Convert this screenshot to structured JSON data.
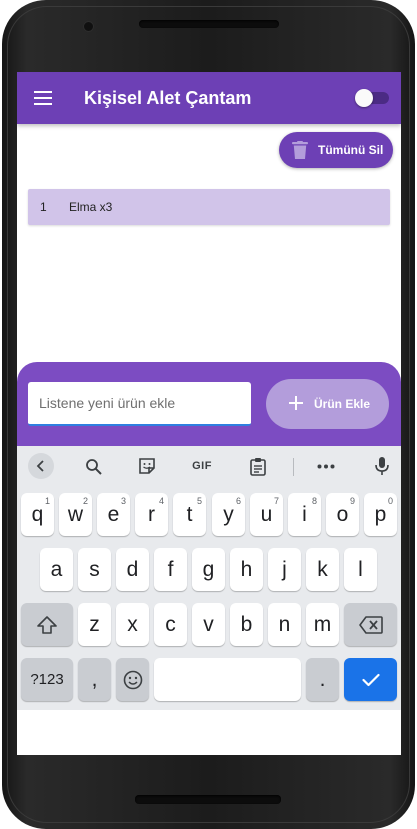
{
  "app": {
    "title": "Kişisel Alet Çantam",
    "toggle_state": "off"
  },
  "actions": {
    "delete_all_label": "Tümünü Sil",
    "add_label": "Ürün Ekle"
  },
  "list": {
    "items": [
      {
        "index": "1",
        "text": "Elma x3"
      }
    ]
  },
  "input": {
    "placeholder": "Listene yeni ürün ekle",
    "value": ""
  },
  "keyboard": {
    "toolbar": [
      "chevron-left-icon",
      "search-icon",
      "sticker-icon",
      "GIF",
      "clipboard-icon",
      "more-icon",
      "mic-icon"
    ],
    "gif_label": "GIF",
    "row1": [
      {
        "key": "q",
        "hint": "1"
      },
      {
        "key": "w",
        "hint": "2"
      },
      {
        "key": "e",
        "hint": "3"
      },
      {
        "key": "r",
        "hint": "4"
      },
      {
        "key": "t",
        "hint": "5"
      },
      {
        "key": "y",
        "hint": "6"
      },
      {
        "key": "u",
        "hint": "7"
      },
      {
        "key": "i",
        "hint": "8"
      },
      {
        "key": "o",
        "hint": "9"
      },
      {
        "key": "p",
        "hint": "0"
      }
    ],
    "row2": [
      "a",
      "s",
      "d",
      "f",
      "g",
      "h",
      "j",
      "k",
      "l"
    ],
    "row3": [
      "z",
      "x",
      "c",
      "v",
      "b",
      "n",
      "m"
    ],
    "symbols_label": "?123",
    "comma_label": ",",
    "period_label": "."
  },
  "colors": {
    "primary": "#6d40b5",
    "panel": "#7c4cc2",
    "list_item_bg": "#d1c4e9",
    "add_button": "#b39ddb",
    "keyboard_accent": "#1a73e8"
  }
}
